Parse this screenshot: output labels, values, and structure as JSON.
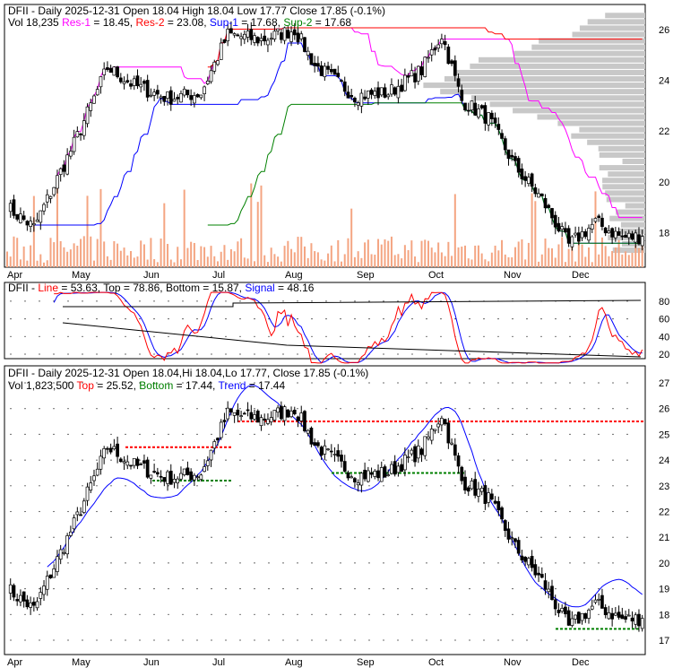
{
  "chart_data": [
    {
      "type": "candlestick",
      "title": "DFII - Daily 2025-12-31",
      "panel": "price",
      "header": {
        "open": "Open 18.04",
        "high": "High 18.04",
        "low": "Low 17.77",
        "close": "Close 17.85 (-0.1%)",
        "vol": "Vol 18,235",
        "res1_label": "Res-1",
        "res1": "= 18.45,",
        "res2_label": "Res-2",
        "res2": "= 23.08,",
        "sup1_label": "Sup-1",
        "sup1": "= 17.68,",
        "sup2_label": "Sup-2",
        "sup2": "= 17.68"
      },
      "yticks": [
        "26",
        "24",
        "22",
        "20",
        "18"
      ],
      "ylim": [
        16.5,
        26.9
      ],
      "months": [
        "Apr",
        "May",
        "Jun",
        "Jul",
        "Aug",
        "Sep",
        "Oct",
        "Nov",
        "Dec"
      ],
      "price_path": [
        [
          0,
          19
        ],
        [
          8,
          18.2
        ],
        [
          20,
          21.5
        ],
        [
          30,
          24.5
        ],
        [
          38,
          23.8
        ],
        [
          48,
          23.3
        ],
        [
          58,
          23.5
        ],
        [
          66,
          25.8
        ],
        [
          76,
          25.6
        ],
        [
          86,
          26
        ],
        [
          92,
          24.6
        ],
        [
          104,
          23.4
        ],
        [
          114,
          23.5
        ],
        [
          124,
          24.4
        ],
        [
          130,
          25.8
        ],
        [
          136,
          23.2
        ],
        [
          144,
          22.5
        ],
        [
          152,
          20.6
        ],
        [
          160,
          19.3
        ],
        [
          168,
          17.5
        ],
        [
          176,
          18.4
        ],
        [
          184,
          17.8
        ],
        [
          190,
          17.85
        ]
      ],
      "colors": {
        "res1": "#ff00ff",
        "res2": "#ff0000",
        "sup1": "#0000ff",
        "sup2": "#008000",
        "volume": "#f4a582"
      }
    },
    {
      "type": "line",
      "panel": "stochastic",
      "title": "DFII",
      "header": {
        "line_label": "Line",
        "line": "= 53.63,",
        "top": "Top = 78.86, Bottom = 15.87,",
        "signal_label": "Signal",
        "signal": "= 48.16"
      },
      "yticks": [
        "80",
        "60",
        "40",
        "20"
      ],
      "ylim": [
        0,
        100
      ]
    },
    {
      "type": "candlestick",
      "panel": "trend",
      "title": "DFII - Daily 2025-12-31",
      "header": {
        "ohlc": "Open 18.04,Hi 18.04,Lo 17.77, Close 17.85 (-0.1%)",
        "vol": "Vol 1,823,500",
        "top_label": "Top",
        "top": "= 25.52,",
        "bottom_label": "Bottom",
        "bottom": "= 17.44,",
        "trend_label": "Trend",
        "trend": "= 17.44"
      },
      "yticks": [
        "27",
        "26",
        "25",
        "24",
        "23",
        "22",
        "21",
        "20",
        "19",
        "18",
        "17"
      ],
      "ylim": [
        16.4,
        27.6
      ]
    }
  ]
}
